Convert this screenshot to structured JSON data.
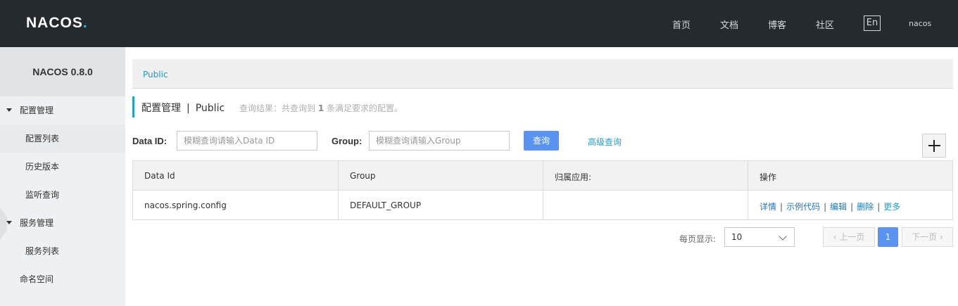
{
  "header": {
    "logo_main": "NACOS",
    "logo_dot": ".",
    "nav": [
      "首页",
      "文档",
      "博客",
      "社区"
    ],
    "lang": "En",
    "user": "nacos"
  },
  "sidebar": {
    "title": "NACOS 0.8.0",
    "groups": [
      {
        "label": "配置管理",
        "items": [
          "配置列表",
          "历史版本",
          "监听查询"
        ]
      },
      {
        "label": "服务管理",
        "items": [
          "服务列表"
        ]
      }
    ],
    "namespace": "命名空间"
  },
  "main": {
    "namespace_tab": "Public",
    "title": "配置管理",
    "title_sep": "|",
    "title_ns": "Public",
    "result_prefix": "查询结果：共查询到",
    "result_count": "1",
    "result_suffix": "条满足要求的配置。",
    "search": {
      "data_id_label": "Data ID:",
      "data_id_placeholder": "模糊查询请输入Data ID",
      "group_label": "Group:",
      "group_placeholder": "模糊查询请输入Group",
      "query_button": "查询",
      "advanced_link": "高级查询"
    },
    "table": {
      "headers": [
        "Data Id",
        "Group",
        "归属应用:",
        "操作"
      ],
      "rows": [
        {
          "data_id": "nacos.spring.config",
          "group": "DEFAULT_GROUP",
          "app": ""
        }
      ],
      "ops": [
        "详情",
        "示例代码",
        "编辑",
        "删除",
        "更多"
      ],
      "op_sep": "|"
    },
    "pagination": {
      "page_size_label": "每页显示:",
      "page_size": "10",
      "prev": "上一页",
      "current": "1",
      "next": "下一页"
    }
  },
  "colors": {
    "header_bg": "#252a2f",
    "accent": "#1fa1cc",
    "primary_button": "#5b93f0"
  }
}
